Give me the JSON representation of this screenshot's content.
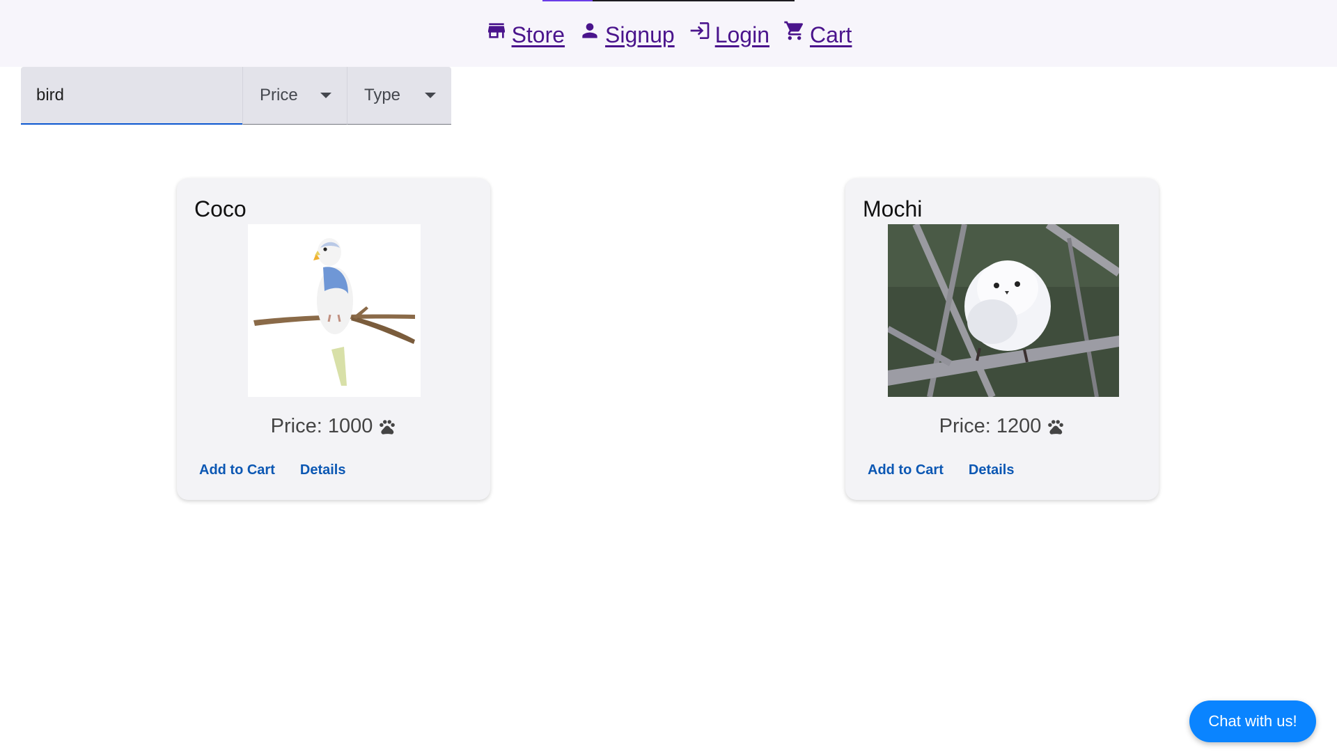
{
  "header": {
    "progress_fraction": 0.2,
    "nav": [
      {
        "label": "Store",
        "icon": "store-icon"
      },
      {
        "label": "Signup",
        "icon": "person-icon"
      },
      {
        "label": "Login",
        "icon": "login-icon"
      },
      {
        "label": "Cart",
        "icon": "cart-icon"
      }
    ]
  },
  "filters": {
    "search_value": "bird",
    "price_label": "Price",
    "type_label": "Type"
  },
  "products": [
    {
      "name": "Coco",
      "price_text": "Price: 1000",
      "add_label": "Add to Cart",
      "details_label": "Details",
      "image": "blue-budgie-on-branch"
    },
    {
      "name": "Mochi",
      "price_text": "Price: 1200",
      "add_label": "Add to Cart",
      "details_label": "Details",
      "image": "white-long-tailed-tit-on-branch"
    }
  ],
  "chat": {
    "label": "Chat with us!"
  },
  "colors": {
    "nav_link": "#4a148c",
    "action": "#0b57b3",
    "chat_bg": "#0a84ff",
    "focus_underline": "#0b57d0"
  }
}
